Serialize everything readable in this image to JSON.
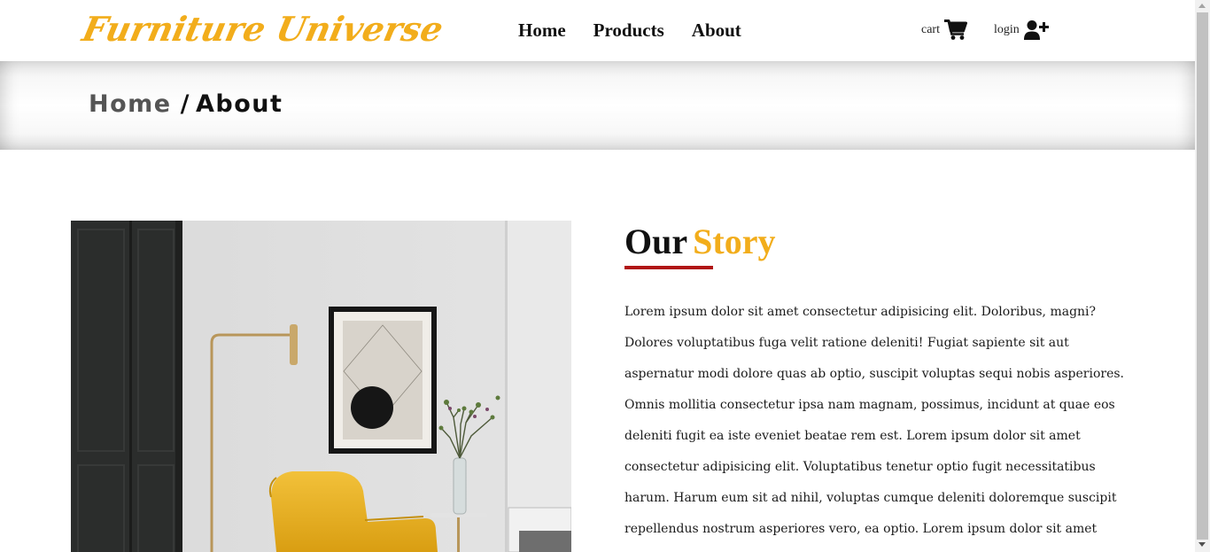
{
  "brand": {
    "name": "Furniture Universe",
    "color": "#f2ad1b"
  },
  "nav": {
    "items": [
      {
        "label": "Home"
      },
      {
        "label": "Products"
      },
      {
        "label": "About"
      }
    ]
  },
  "utilities": {
    "cart_label": "cart",
    "cart_icon": "shopping-cart-icon",
    "login_label": "login",
    "login_icon": "user-plus-icon"
  },
  "breadcrumb": {
    "home": "Home",
    "separator": "/",
    "current": "About"
  },
  "story": {
    "title_word1": "Our",
    "title_word2": "Story",
    "underline_color": "#b01515",
    "body": "Lorem ipsum dolor sit amet consectetur adipisicing elit. Doloribus, magni? Dolores voluptatibus fuga velit ratione deleniti! Fugiat sapiente sit aut aspernatur modi dolore quas ab optio, suscipit voluptas sequi nobis asperiores. Omnis mollitia consectetur ipsa nam magnam, possimus, incidunt at quae eos deleniti fugit ea iste eveniet beatae rem est. Lorem ipsum dolor sit amet consectetur adipisicing elit. Voluptatibus tenetur optio fugit necessitatibus harum. Harum eum sit ad nihil, voluptas cumque deleniti doloremque suscipit repellendus nostrum asperiores vero, ea optio. Lorem ipsum dolor sit amet consectetur adipisicing elit."
  }
}
